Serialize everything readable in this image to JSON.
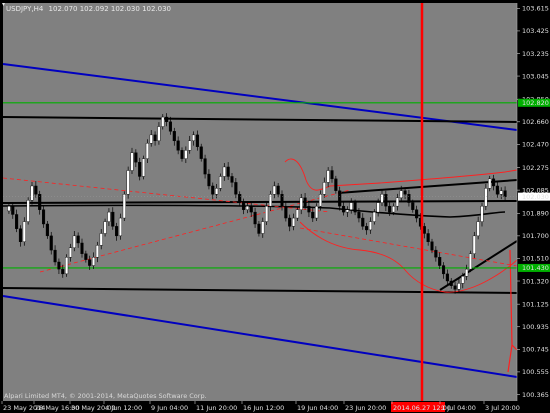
{
  "chart_header": {
    "symbol_timeframe": "USDJPY,H4",
    "ohlc": "102.070 102.092 102.030 102.030"
  },
  "footer_text": "Alpari Limited MT4, © 2001-2014, MetaQuotes Software Corp.",
  "colors": {
    "background": "#000000",
    "plot_area": "#808080",
    "candle": "#000000",
    "green_level": "#00b000",
    "blue_channel": "#0000c0",
    "red_lines": "#ff2020",
    "axis_text": "#e0e0e0",
    "price_tag": "#000000",
    "time_tag": "#ff0000"
  },
  "chart_data": {
    "type": "candlestick",
    "title": "",
    "ylim": [
      100.31,
      103.66
    ],
    "price_ticks": [
      "103.615",
      "103.425",
      "103.235",
      "103.045",
      "102.850",
      "102.660",
      "102.470",
      "102.275",
      "102.085",
      "101.890",
      "101.700",
      "101.510",
      "101.320",
      "101.125",
      "100.935",
      "100.745",
      "100.555",
      "100.365"
    ],
    "time_ticks": [
      "23 May 2014",
      "28 May 16:00",
      "30 May 20:00",
      "4 Jun 12:00",
      "9 Jun 04:00",
      "11 Jun 20:00",
      "16 Jun 12:00",
      "19 Jun 04:00",
      "23 Jun 20:00",
      "2014.06.27 12:00",
      "1 Jul 04:00",
      "3 Jul 20:00"
    ],
    "current_price": "102.030",
    "green_levels": [
      {
        "value": 102.82,
        "label": "102.820"
      },
      {
        "value": 101.43,
        "label": "101.430"
      }
    ],
    "cursor_time_label": "2014.06.27 12:00",
    "closes": [
      101.95,
      101.88,
      101.76,
      101.65,
      101.82,
      102.0,
      102.12,
      102.05,
      101.92,
      101.8,
      101.7,
      101.58,
      101.48,
      101.42,
      101.38,
      101.52,
      101.6,
      101.7,
      101.64,
      101.55,
      101.5,
      101.45,
      101.52,
      101.62,
      101.72,
      101.82,
      101.9,
      101.78,
      101.7,
      101.85,
      102.05,
      102.25,
      102.4,
      102.32,
      102.2,
      102.35,
      102.48,
      102.55,
      102.5,
      102.62,
      102.7,
      102.66,
      102.58,
      102.5,
      102.42,
      102.35,
      102.42,
      102.5,
      102.55,
      102.45,
      102.35,
      102.22,
      102.12,
      102.05,
      102.1,
      102.2,
      102.28,
      102.2,
      102.15,
      102.05,
      101.98,
      101.92,
      101.95,
      101.9,
      101.8,
      101.72,
      101.82,
      101.95,
      102.05,
      102.12,
      102.05,
      101.95,
      101.85,
      101.78,
      101.85,
      101.92,
      102.02,
      101.95,
      101.9,
      101.85,
      101.95,
      102.05,
      102.15,
      102.25,
      102.18,
      102.08,
      101.95,
      101.9,
      101.92,
      101.98,
      101.9,
      101.85,
      101.78,
      101.75,
      101.82,
      101.9,
      101.98,
      102.05,
      101.95,
      101.9,
      101.95,
      102.02,
      102.08,
      102.05,
      101.98,
      101.92,
      101.85,
      101.78,
      101.72,
      101.65,
      101.58,
      101.52,
      101.45,
      101.38,
      101.32,
      101.28,
      101.25,
      101.3,
      101.36,
      101.42,
      101.55,
      101.7,
      101.82,
      101.95,
      102.1,
      102.18,
      102.12,
      102.05,
      102.08,
      102.03
    ]
  }
}
